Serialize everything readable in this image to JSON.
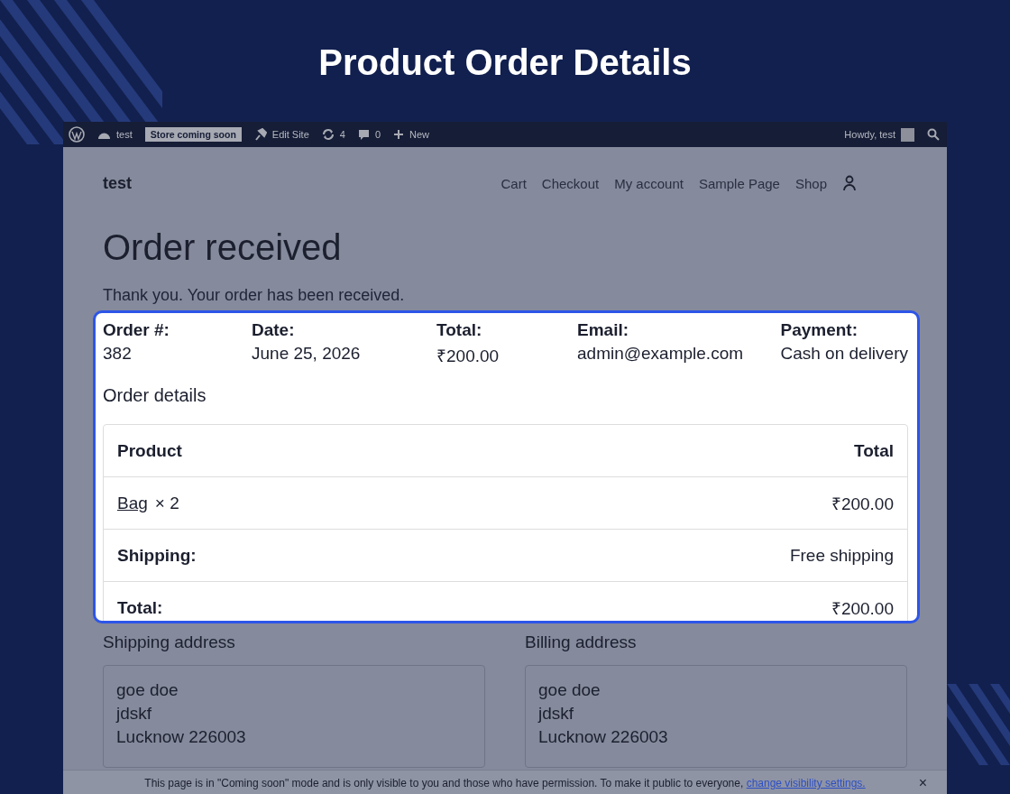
{
  "page_title": "Product Order Details",
  "admin_bar": {
    "site": "test",
    "badge": "Store coming soon",
    "edit": "Edit Site",
    "updates": "4",
    "comments": "0",
    "new": "New",
    "howdy": "Howdy, test"
  },
  "site": {
    "name": "test",
    "nav": [
      "Cart",
      "Checkout",
      "My account",
      "Sample Page",
      "Shop"
    ]
  },
  "heading": "Order received",
  "thanks": "Thank you. Your order has been received.",
  "overview": [
    {
      "label": "Order #:",
      "value": "382"
    },
    {
      "label": "Date:",
      "value": "June 25, 2026"
    },
    {
      "label": "Total:",
      "value": "₹200.00"
    },
    {
      "label": "Email:",
      "value": "admin@example.com"
    },
    {
      "label": "Payment:",
      "value": "Cash on delivery"
    }
  ],
  "details_title": "Order details",
  "table": {
    "columns": [
      "Product",
      "Total"
    ],
    "rows": [
      {
        "kind": "item",
        "label": "Bag",
        "qty": "× 2",
        "total": "₹200.00"
      },
      {
        "kind": "summary",
        "label": "Shipping:",
        "total": "Free shipping"
      },
      {
        "kind": "summary",
        "label": "Total:",
        "total": "₹200.00"
      }
    ]
  },
  "addresses": [
    {
      "title": "Shipping address",
      "lines": [
        "goe doe",
        "jdskf",
        "Lucknow 226003"
      ]
    },
    {
      "title": "Billing address",
      "lines": [
        "goe doe",
        "jdskf",
        "Lucknow 226003"
      ]
    }
  ],
  "notice": {
    "text": "This page is in \"Coming soon\" mode and is only visible to you and those who have permission. To make it public to everyone,",
    "link": "change visibility settings.",
    "close": "×"
  }
}
